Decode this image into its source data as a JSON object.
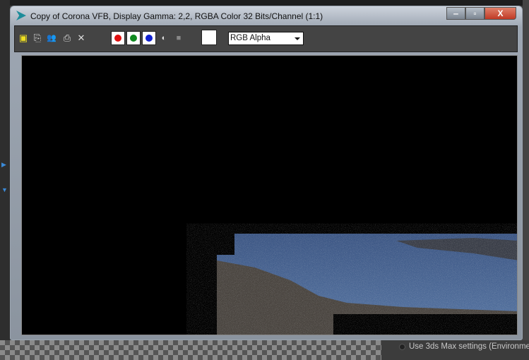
{
  "window": {
    "title": "Copy of Corona VFB, Display Gamma: 2,2, RGBA Color 32 Bits/Channel (1:1)"
  },
  "toolbar": {
    "channel_select": "RGB Alpha",
    "channels": [
      {
        "name": "red",
        "color": "#e01010"
      },
      {
        "name": "green",
        "color": "#108a20"
      },
      {
        "name": "blue",
        "color": "#1020d0"
      }
    ]
  },
  "background": {
    "env_option": "Use 3ds Max settings (Environment"
  }
}
